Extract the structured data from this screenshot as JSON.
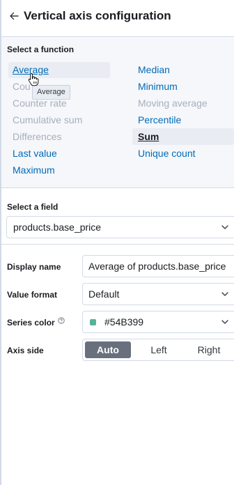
{
  "header": {
    "title": "Vertical axis configuration"
  },
  "function_section": {
    "label": "Select a function",
    "left_column": [
      {
        "label": "Average",
        "state": "hovered"
      },
      {
        "label": "Count",
        "state": "disabled"
      },
      {
        "label": "Counter rate",
        "state": "disabled"
      },
      {
        "label": "Cumulative sum",
        "state": "disabled"
      },
      {
        "label": "Differences",
        "state": "disabled"
      },
      {
        "label": "Last value",
        "state": "enabled"
      },
      {
        "label": "Maximum",
        "state": "enabled"
      }
    ],
    "right_column": [
      {
        "label": "Median",
        "state": "enabled"
      },
      {
        "label": "Minimum",
        "state": "enabled"
      },
      {
        "label": "Moving average",
        "state": "disabled"
      },
      {
        "label": "Percentile",
        "state": "enabled"
      },
      {
        "label": "Sum",
        "state": "selected"
      },
      {
        "label": "Unique count",
        "state": "enabled"
      }
    ],
    "tooltip": "Average",
    "count_visible_text": "Cou"
  },
  "field_section": {
    "label": "Select a field",
    "value": "products.base_price"
  },
  "display_name": {
    "label": "Display name",
    "value": "Average of products.base_price"
  },
  "value_format": {
    "label": "Value format",
    "value": "Default"
  },
  "series_color": {
    "label": "Series color",
    "value": "#54B399"
  },
  "axis_side": {
    "label": "Axis side",
    "options": [
      "Auto",
      "Left",
      "Right"
    ],
    "selected": "Auto"
  },
  "colors": {
    "link": "#006bb8",
    "disabled": "#a7afbe",
    "swatch": "#54B399",
    "active_segment": "#69707d"
  }
}
